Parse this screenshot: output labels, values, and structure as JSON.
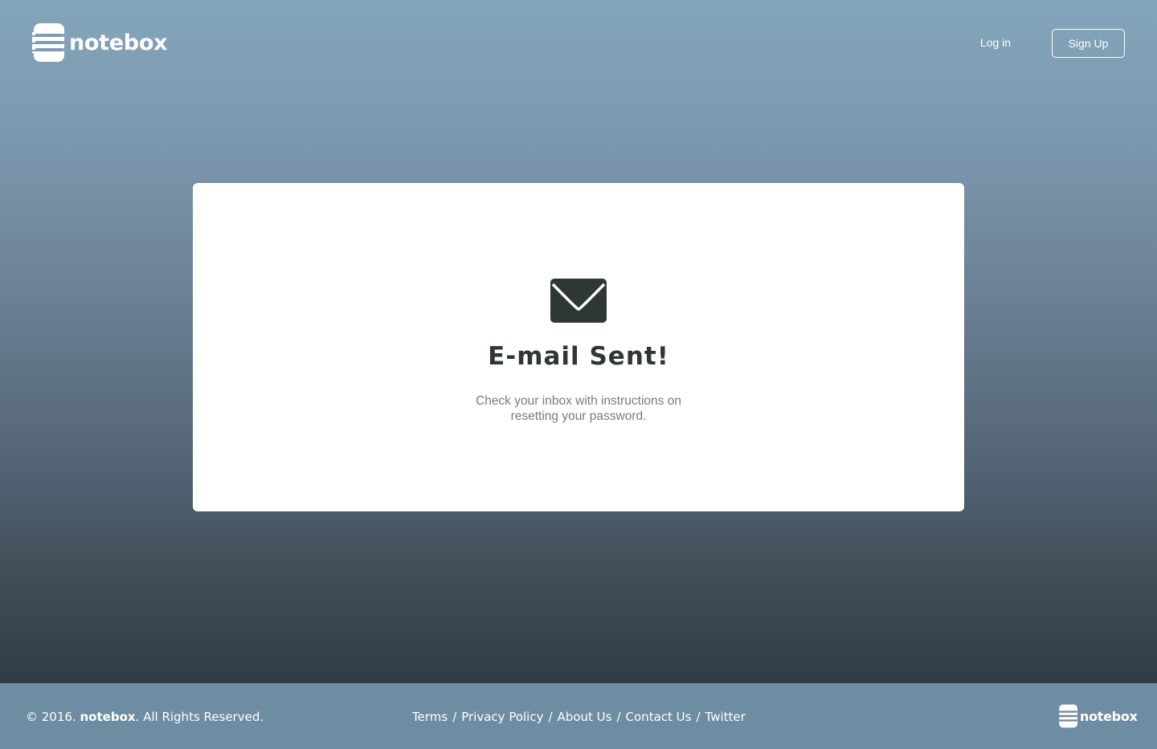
{
  "header": {
    "logo_text": "notebox",
    "login_label": "Log in",
    "signup_label": "Sign Up"
  },
  "card": {
    "icon": "envelope-icon",
    "title": "E-mail Sent!",
    "message": "Check your inbox with instructions on resetting your password."
  },
  "footer": {
    "copyright_prefix": "© 2016.",
    "copyright_brand": "notebox",
    "copyright_suffix": ". All Rights Reserved.",
    "links": [
      "Terms",
      "Privacy Policy",
      "About Us",
      "Contact Us",
      "Twitter"
    ],
    "separator": "/",
    "logo_text": "notebox"
  },
  "colors": {
    "gradient_top": "#84a5bb",
    "gradient_bottom": "#323c45",
    "footer_bg": "#6e8da2",
    "card_bg": "#ffffff",
    "title_color": "#2f3734",
    "body_text": "#7a7a7a"
  }
}
